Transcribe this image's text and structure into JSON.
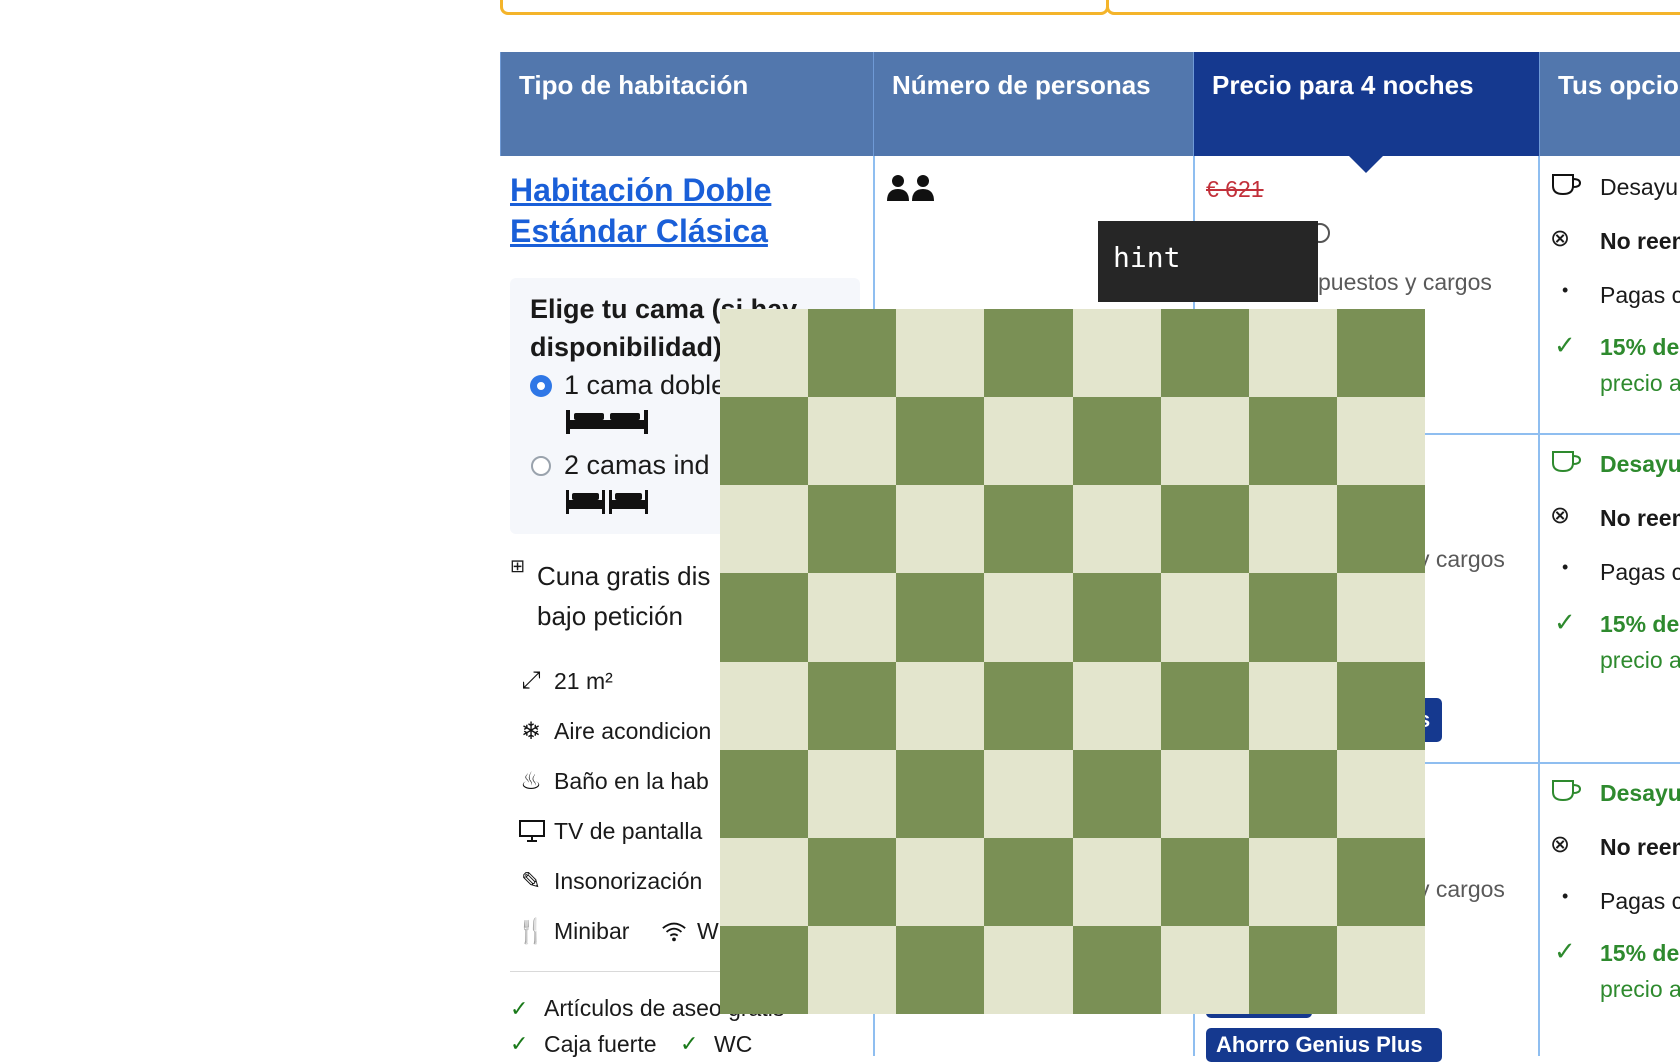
{
  "table": {
    "headers": [
      "Tipo de habitación",
      "Número de personas",
      "Precio para 4 noches",
      "Tus opcio"
    ]
  },
  "room": {
    "title": "Habitación Doble Estándar Clásica",
    "bed_choice": {
      "heading": "Elige tu cama (si hay disponibilidad)",
      "options": [
        {
          "label": "1 cama doble",
          "selected": true
        },
        {
          "label": "2 camas ind",
          "selected": false
        }
      ]
    },
    "crib": {
      "line1": "Cuna gratis dis",
      "line2": "bajo petición"
    },
    "amenities": {
      "size": "21 m²",
      "ac": "Aire acondicion",
      "bath": "Baño en la hab",
      "tv": "TV de pantalla",
      "soundproof": "Insonorización",
      "minibar": "Minibar",
      "wifi": "W"
    },
    "extras": {
      "toiletries": "Artículos de aseo gratis",
      "safe": "Caja fuerte",
      "wc": "WC"
    }
  },
  "price": {
    "old_price": "€ 621",
    "taxes_text": "puestos y cargos",
    "taxes_text_short": "y cargos",
    "partial_badge": "s",
    "genius_badge": "Ahorro Genius Plus"
  },
  "options": [
    {
      "breakfast": "Desayu",
      "breakfast_bold": false,
      "refund": "No reem",
      "pay": "Pagas c",
      "discount": "15% de",
      "discount_sub": "precio a"
    },
    {
      "breakfast": "Desayu",
      "breakfast_bold": true,
      "refund": "No reem",
      "pay": "Pagas c",
      "discount": "15% de",
      "discount_sub": "precio a"
    },
    {
      "breakfast": "Desayu",
      "breakfast_bold": true,
      "refund": "No reem",
      "pay": "Pagas c",
      "discount": "15% de",
      "discount_sub": "precio a"
    }
  ],
  "tooltip": {
    "text": "hint"
  },
  "colors": {
    "header": "#5277ad",
    "header_active": "#15398f",
    "link": "#1a5fd8",
    "green": "#2e8a2e",
    "board_light": "#e3e5cd",
    "board_dark": "#7a9055"
  }
}
